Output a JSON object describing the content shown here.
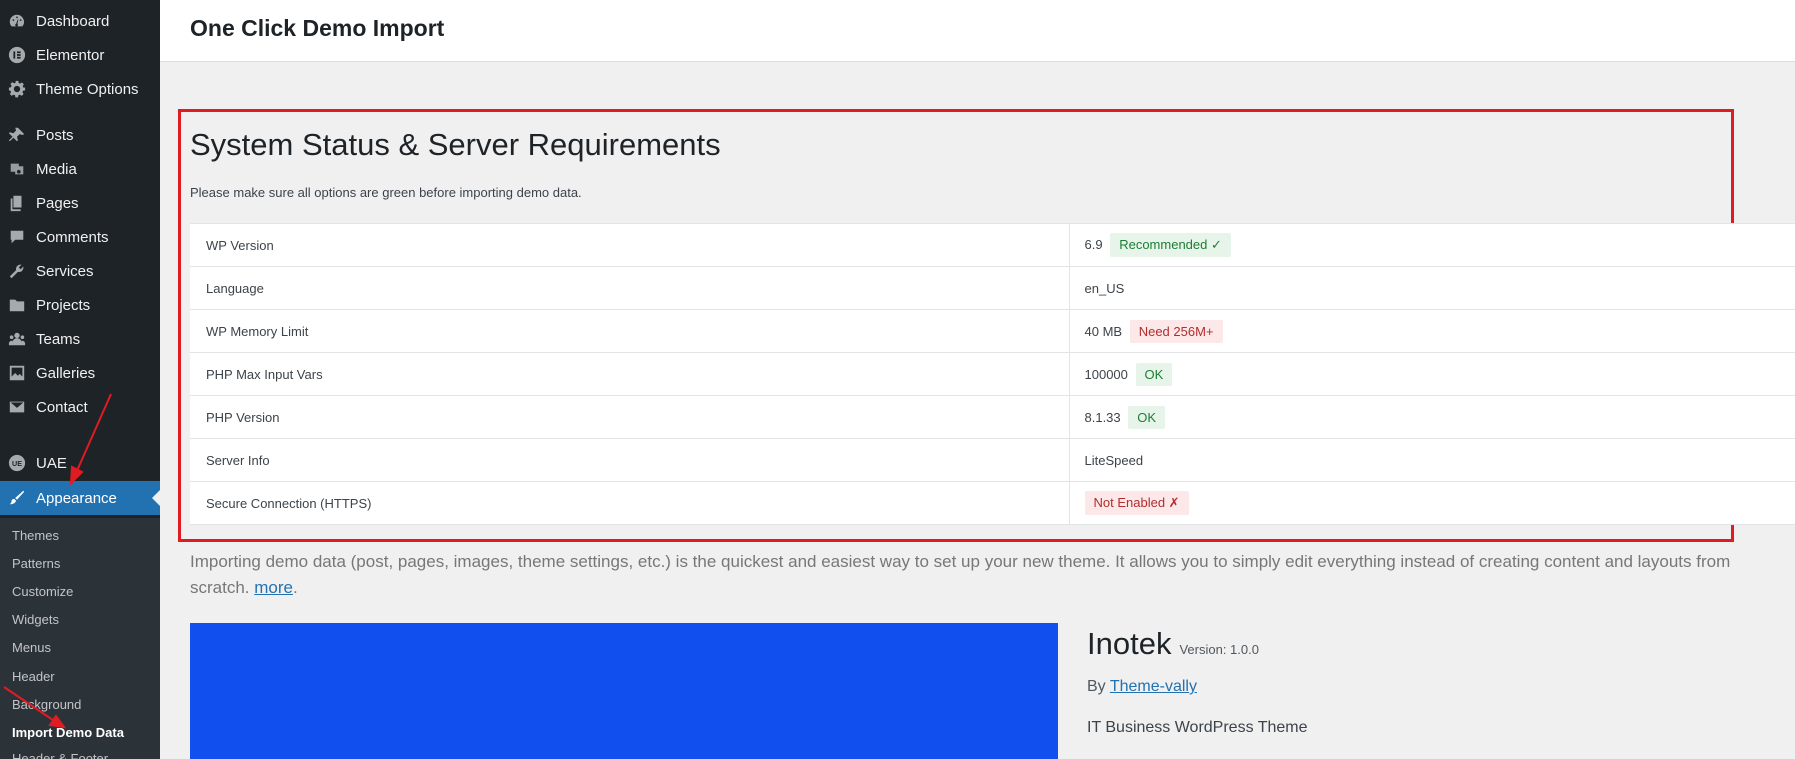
{
  "sidebar": {
    "items": [
      {
        "label": "Dashboard",
        "icon": "dashboard-icon"
      },
      {
        "label": "Elementor",
        "icon": "elementor-icon"
      },
      {
        "label": "Theme Options",
        "icon": "gear-icon"
      },
      {
        "label": "Posts",
        "icon": "pin-icon"
      },
      {
        "label": "Media",
        "icon": "media-icon"
      },
      {
        "label": "Pages",
        "icon": "pages-icon"
      },
      {
        "label": "Comments",
        "icon": "comments-icon"
      },
      {
        "label": "Services",
        "icon": "wrench-icon"
      },
      {
        "label": "Projects",
        "icon": "folder-icon"
      },
      {
        "label": "Teams",
        "icon": "groups-icon"
      },
      {
        "label": "Galleries",
        "icon": "gallery-icon"
      },
      {
        "label": "Contact",
        "icon": "email-icon"
      },
      {
        "label": "UAE",
        "icon": "uae-icon"
      },
      {
        "label": "Appearance",
        "icon": "brush-icon"
      }
    ],
    "submenu": [
      {
        "label": "Themes"
      },
      {
        "label": "Patterns"
      },
      {
        "label": "Customize"
      },
      {
        "label": "Widgets"
      },
      {
        "label": "Menus"
      },
      {
        "label": "Header"
      },
      {
        "label": "Background"
      },
      {
        "label": "Import Demo Data"
      },
      {
        "label": "Header & Footer"
      }
    ]
  },
  "page": {
    "title": "One Click Demo Import"
  },
  "status": {
    "heading": "System Status & Server Requirements",
    "note": "Please make sure all options are green before importing demo data.",
    "rows": [
      {
        "label": "WP Version",
        "value": "6.9",
        "badge": "Recommended ✓",
        "badge_color": "#1e7e34"
      },
      {
        "label": "Language",
        "value": "en_US",
        "badge": ""
      },
      {
        "label": "WP Memory Limit",
        "value": "40 MB",
        "badge": "Need 256M+",
        "badge_color": "#b32d2e"
      },
      {
        "label": "PHP Max Input Vars",
        "value": "100000",
        "badge": "OK",
        "badge_color": "#1e7e34"
      },
      {
        "label": "PHP Version",
        "value": "8.1.33",
        "badge": "OK",
        "badge_color": "#1e7e34"
      },
      {
        "label": "Server Info",
        "value": "LiteSpeed",
        "badge": ""
      },
      {
        "label": "Secure Connection (HTTPS)",
        "value": "",
        "badge": "Not Enabled ✗",
        "badge_color": "#b32d2e"
      }
    ]
  },
  "intro": {
    "text": "Importing demo data (post, pages, images, theme settings, etc.) is the quickest and easiest way to set up your new theme. It allows you to simply edit everything instead of creating content and layouts from scratch.",
    "link_text": "more"
  },
  "demo": {
    "name": "Inotek",
    "version": "Version: 1.0.0",
    "by_label": "By",
    "author": "Theme-vally",
    "description": "IT Business WordPress Theme"
  },
  "colors": {
    "sidebar_bg": "#1d2327",
    "accent": "#2271b1",
    "highlight_border": "#e11b22",
    "preview_bg": "#1150ee"
  }
}
